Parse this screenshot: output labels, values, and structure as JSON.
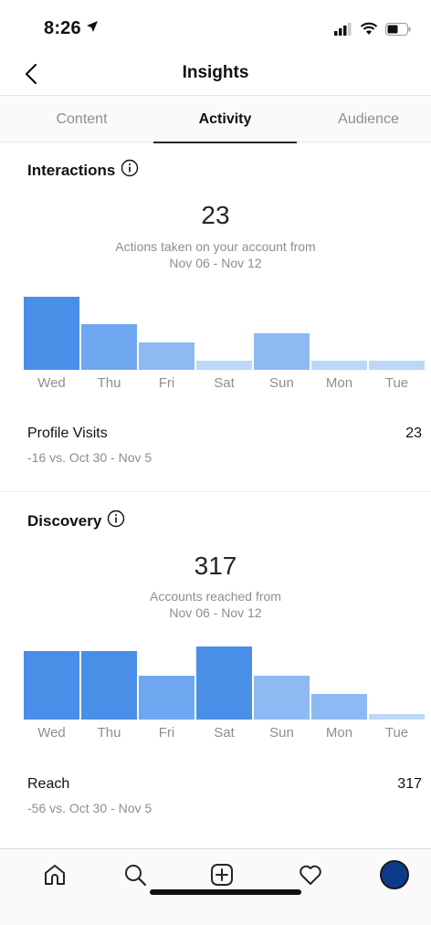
{
  "status_bar": {
    "time": "8:26"
  },
  "header": {
    "title": "Insights"
  },
  "tabs": [
    {
      "label": "Content",
      "active": false
    },
    {
      "label": "Activity",
      "active": true
    },
    {
      "label": "Audience",
      "active": false
    }
  ],
  "interactions": {
    "title": "Interactions",
    "total": "23",
    "caption_line1": "Actions taken on your account from",
    "caption_line2": "Nov 06 - Nov 12",
    "chart": {
      "days": [
        "Wed",
        "Thu",
        "Fri",
        "Sat",
        "Sun",
        "Mon",
        "Tue"
      ],
      "values": [
        1.0,
        0.62,
        0.37,
        0.12,
        0.5,
        0.12,
        0.12
      ],
      "shades": [
        "#4a8fe7",
        "#6ea7f0",
        "#8dbaf3",
        "#bcd7f8",
        "#8dbaf3",
        "#bcd7f8",
        "#bcd7f8"
      ]
    },
    "stat": {
      "label": "Profile Visits",
      "value": "23",
      "compare": "-16 vs. Oct 30 - Nov 5"
    }
  },
  "discovery": {
    "title": "Discovery",
    "total": "317",
    "caption_line1": "Accounts reached from",
    "caption_line2": "Nov 06 - Nov 12",
    "chart": {
      "days": [
        "Wed",
        "Thu",
        "Fri",
        "Sat",
        "Sun",
        "Mon",
        "Tue"
      ],
      "values": [
        0.94,
        0.94,
        0.6,
        1.0,
        0.6,
        0.35,
        0.08
      ],
      "shades": [
        "#4a8fe7",
        "#4a8fe7",
        "#6ea7f0",
        "#4a8fe7",
        "#8dbaf3",
        "#8dbaf3",
        "#bcd7f8"
      ]
    },
    "stat": {
      "label": "Reach",
      "value": "317",
      "compare": "-56 vs. Oct 30 - Nov 5"
    }
  },
  "bottom_nav": {
    "items": [
      "home-icon",
      "search-icon",
      "add-post-icon",
      "heart-icon",
      "profile-avatar"
    ]
  }
}
